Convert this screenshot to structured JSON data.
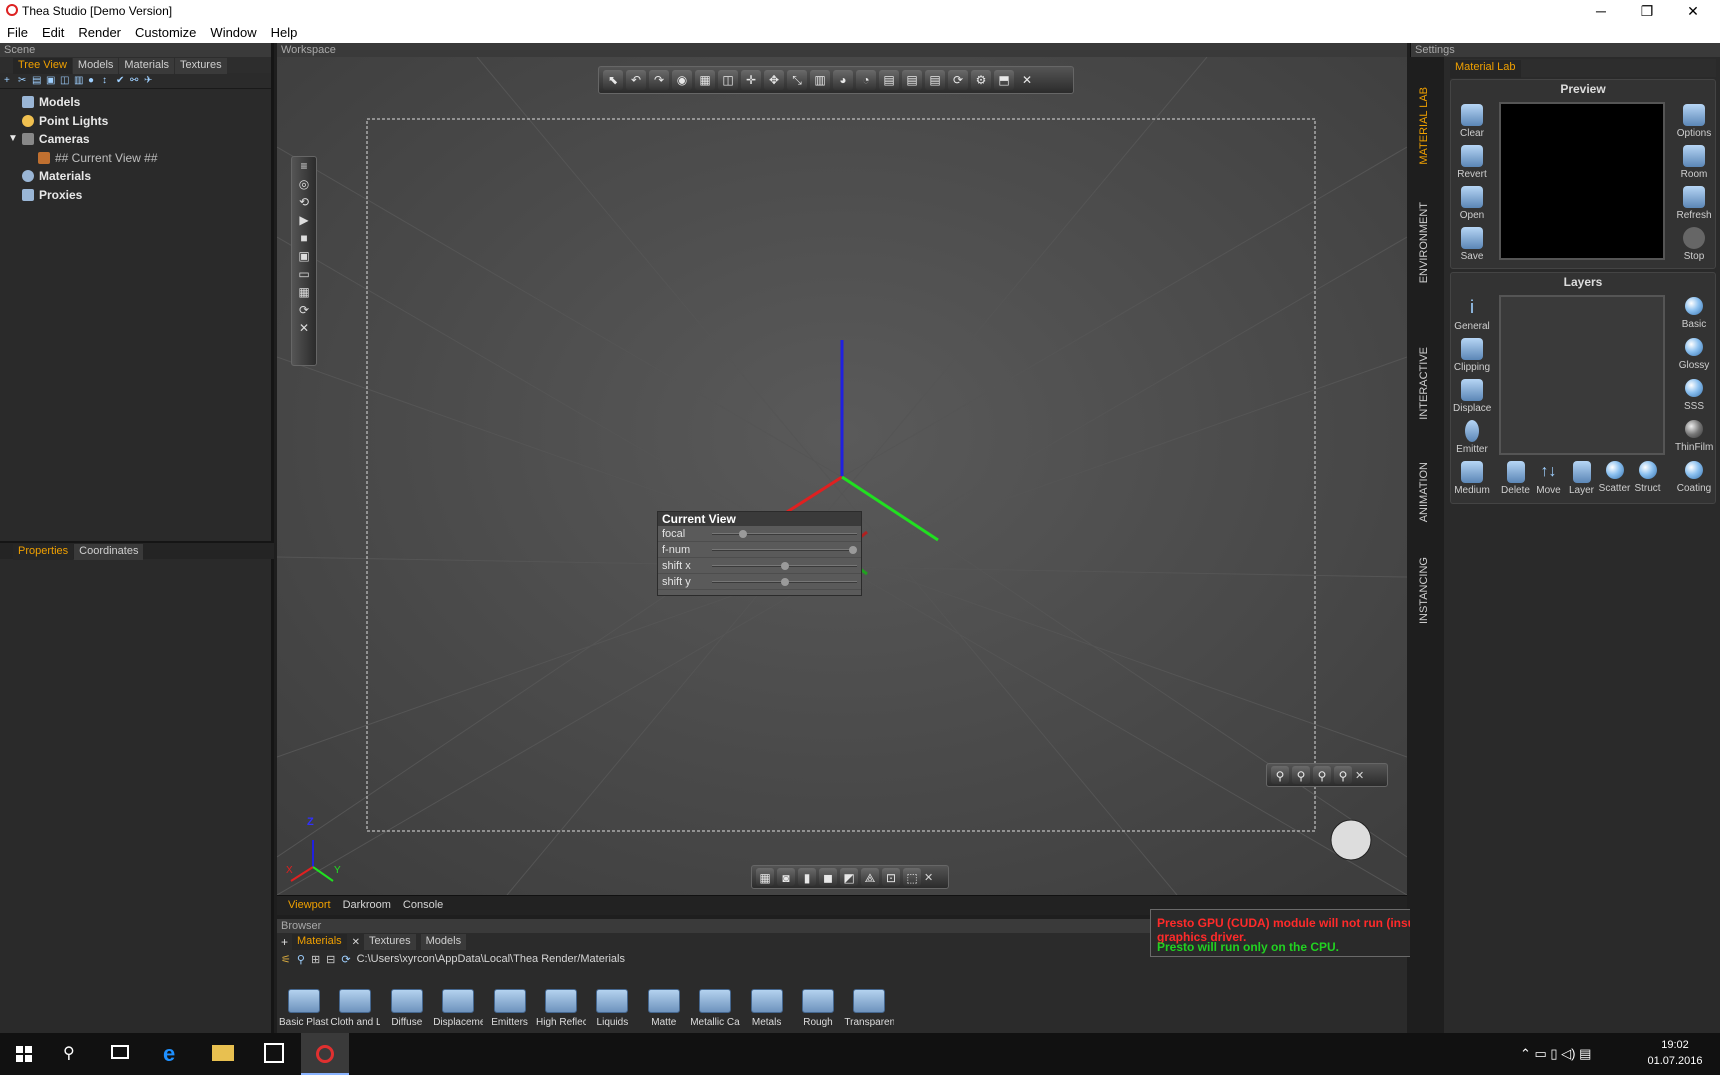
{
  "window": {
    "title": "Thea Studio [Demo Version]",
    "minimize": "─",
    "maximize": "❐",
    "close": "✕"
  },
  "menu": [
    "File",
    "Edit",
    "Render",
    "Customize",
    "Window",
    "Help"
  ],
  "scene": {
    "panel_title": "Scene",
    "tabs": [
      "Tree View",
      "Models",
      "Materials",
      "Textures"
    ],
    "tree": [
      {
        "label": "Models"
      },
      {
        "label": "Point Lights"
      },
      {
        "label": "Cameras"
      },
      {
        "label": "## Current View ##"
      },
      {
        "label": "Materials"
      },
      {
        "label": "Proxies"
      }
    ],
    "bottom_tabs": [
      "Properties",
      "Coordinates"
    ]
  },
  "workspace": {
    "title": "Workspace",
    "camera_window": {
      "title": "Current View",
      "params": [
        {
          "label": "focal",
          "level": 0.2
        },
        {
          "label": "f-num",
          "level": 1.0
        },
        {
          "label": "shift x",
          "level": 0.5
        },
        {
          "label": "shift y",
          "level": 0.5
        }
      ]
    },
    "axis": {
      "z": "Z",
      "x": "X",
      "y": "Y"
    },
    "tabs": [
      "Viewport",
      "Darkroom",
      "Console"
    ]
  },
  "browser": {
    "title": "Browser",
    "tabs": [
      "Materials",
      "Textures",
      "Models"
    ],
    "path": "C:\\Users\\xyrcon\\AppData\\Local\\Thea Render/Materials",
    "folders": [
      "Basic Plasti",
      "Cloth and L",
      "Diffuse",
      "Displaceme",
      "Emitters",
      "High Reflec",
      "Liquids",
      "Matte",
      "Metallic Car",
      "Metals",
      "Rough",
      "Transparent"
    ]
  },
  "gpu_message": {
    "line1": "Presto GPU (CUDA) module will not run (insufficient driver). Update your graphics driver.",
    "line2": "Presto will run only on the CPU.",
    "close": "✕"
  },
  "settings": {
    "panel_title": "Settings",
    "vertical_tabs": [
      "MATERIAL LAB",
      "ENVIRONMENT",
      "INTERACTIVE",
      "ANIMATION",
      "INSTANCING"
    ],
    "tab": "Material Lab",
    "preview": {
      "title": "Preview",
      "left_buttons": [
        "Clear",
        "Revert",
        "Open",
        "Save"
      ],
      "right_buttons": [
        "Options",
        "Room",
        "Refresh",
        "Stop"
      ]
    },
    "layers": {
      "title": "Layers",
      "left_buttons": [
        "General",
        "Clipping",
        "Displace",
        "Emitter",
        "Medium"
      ],
      "right_buttons": [
        "Basic",
        "Glossy",
        "SSS",
        "ThinFilm",
        "Coating"
      ],
      "bottom_buttons": [
        "Delete",
        "Move",
        "Layer",
        "Scatter",
        "Struct"
      ]
    }
  },
  "taskbar": {
    "time": "19:02",
    "date": "01.07.2016"
  },
  "colors": {
    "accent": "#f0a000",
    "axis_x": "#e02020",
    "axis_y": "#20e020",
    "axis_z": "#2020e0"
  }
}
